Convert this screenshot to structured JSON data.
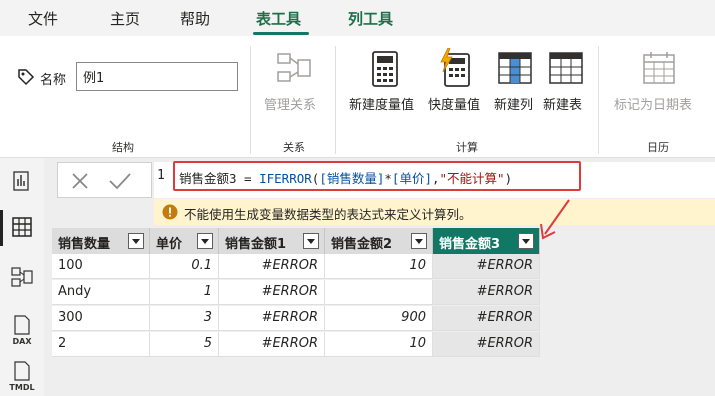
{
  "tabs": [
    "文件",
    "主页",
    "帮助",
    "表工具",
    "列工具"
  ],
  "active_tab": "表工具",
  "ribbon": {
    "name_label": "名称",
    "name_value": "例1",
    "groups": {
      "structure": "结构",
      "relations": "关系",
      "calculations": "计算",
      "calendar": "日历"
    },
    "buttons": {
      "manage_relations": "管理关系",
      "new_measure": "新建度量值",
      "quick_measure": "快度量值",
      "new_column": "新建列",
      "new_table": "新建表",
      "mark_date_table": "标记为日期表"
    }
  },
  "rail": {
    "dax_label": "DAX",
    "tmdl_label": "TMDL"
  },
  "formula_bar": {
    "line_number": "1",
    "tokens": [
      {
        "text": "销售金额3 = ",
        "kind": "plain"
      },
      {
        "text": "IFERROR",
        "kind": "func"
      },
      {
        "text": "(",
        "kind": "plain"
      },
      {
        "text": "[销售数量]",
        "kind": "col"
      },
      {
        "text": "*",
        "kind": "plain"
      },
      {
        "text": "[单价]",
        "kind": "col"
      },
      {
        "text": ",",
        "kind": "plain"
      },
      {
        "text": "\"不能计算\"",
        "kind": "str"
      },
      {
        "text": ")",
        "kind": "plain"
      }
    ],
    "warning": "不能使用生成变量数据类型的表达式来定义计算列。"
  },
  "table": {
    "columns": [
      "销售数量",
      "单价",
      "销售金额1",
      "销售金额2",
      "销售金额3"
    ],
    "active_column": 4,
    "rows": [
      [
        "100",
        "0.1",
        "#ERROR",
        "10",
        "#ERROR"
      ],
      [
        "Andy",
        "1",
        "#ERROR",
        "",
        "#ERROR"
      ],
      [
        "300",
        "3",
        "#ERROR",
        "900",
        "#ERROR"
      ],
      [
        "2",
        "5",
        "#ERROR",
        "10",
        "#ERROR"
      ]
    ]
  },
  "colors": {
    "accent": "#117865",
    "highlight_border": "#e03a3a",
    "warning_bg": "#fff4ce"
  }
}
